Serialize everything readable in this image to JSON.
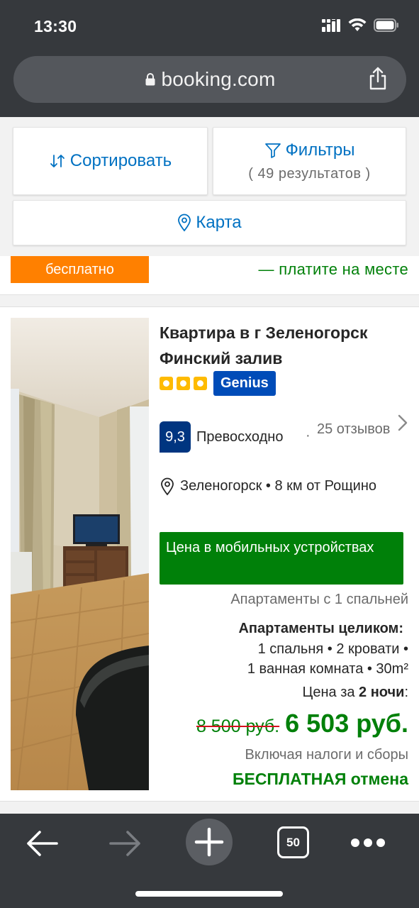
{
  "status_bar": {
    "time": "13:30"
  },
  "browser": {
    "url": "booking.com",
    "tabs_count": "50"
  },
  "controls": {
    "sort_label": "Сортировать",
    "filters_label": "Фильтры",
    "results_label": "( 49 результатов )",
    "map_label": "Карта"
  },
  "previous_listing": {
    "tag": "бесплатно",
    "payment_note": "— платите на месте"
  },
  "listing": {
    "title": "Квартира в г Зеленогорск Финский залив",
    "stars": 3,
    "genius_badge": "Genius",
    "score": "9,3",
    "score_word": "Превосходно",
    "dot": "·",
    "reviews": "25 отзывов",
    "location": "Зеленогорск • 8 км от Рощино",
    "mobile_price_badge": "Цена в мобильных устройствах",
    "room_type": "Апартаменты с 1 спальней",
    "room_heading": "Апартаменты целиком:",
    "room_details_1": "1 спальня • 2 кровати •",
    "room_details_2": "1 ванная комната • 30m²",
    "price_for_prefix": "Цена за",
    "price_for_nights": "2 ночи",
    "price_for_suffix": ":",
    "old_price": "8 500 руб.",
    "new_price": "6 503 руб.",
    "taxes_note": "Включая налоги и сборы",
    "free_cancellation": "БЕСПЛАТНАЯ отмена"
  },
  "colors": {
    "brand_blue": "#0071c2",
    "score_blue": "#003580",
    "genius_blue": "#004cb8",
    "deal_green": "#008009",
    "tag_orange": "#ff8000",
    "star_yellow": "#febb02",
    "chrome_dark": "#36393d"
  },
  "icons": {
    "sort": "sort-arrows-icon",
    "filter": "funnel-icon",
    "map": "map-pin-icon",
    "share": "share-icon",
    "location": "location-pin-icon",
    "chevron": "chevron-right-icon"
  }
}
